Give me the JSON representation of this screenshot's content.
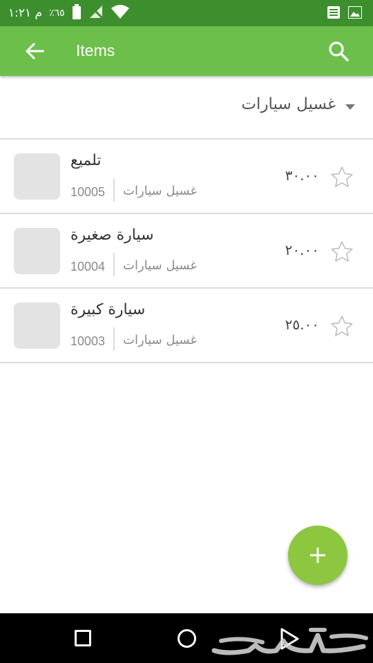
{
  "status_bar": {
    "time": "م ١:٢١",
    "battery_percent": "٪٦٥",
    "icons": [
      "image-icon",
      "list-icon",
      "wifi-icon",
      "no-signal-icon",
      "battery-icon"
    ]
  },
  "app_bar": {
    "title": "Items",
    "back_icon": "arrow-back-icon",
    "search_icon": "search-icon",
    "color": "#6dbf4b"
  },
  "category_filter": {
    "selected": "غسيل سيارات",
    "icon": "caret-down-icon"
  },
  "items": [
    {
      "name": "تلميع",
      "code": "10005",
      "category": "غسيل سيارات",
      "price": "٣٠.٠٠",
      "favorite": false
    },
    {
      "name": "سيارة صغيرة",
      "code": "10004",
      "category": "غسيل سيارات",
      "price": "٢٠.٠٠",
      "favorite": false
    },
    {
      "name": "سيارة كبيرة",
      "code": "10003",
      "category": "غسيل سيارات",
      "price": "٢٥.٠٠",
      "favorite": false
    }
  ],
  "fab": {
    "icon": "plus-icon",
    "color": "#8dc63f"
  },
  "nav_bar": {
    "icons": [
      "recents-icon",
      "home-icon",
      "back-triangle-icon"
    ]
  },
  "watermark": {
    "text": "حراج"
  },
  "colors": {
    "status_bar": "#3d8f2e",
    "divider": "#dcdcdc"
  }
}
